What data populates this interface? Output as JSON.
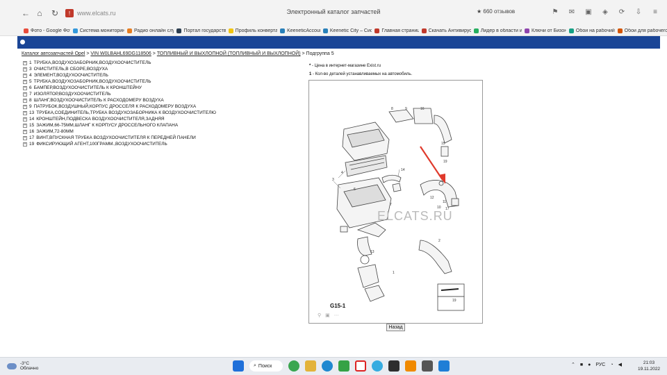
{
  "browser": {
    "url": "www.elcats.ru",
    "title": "Электронный каталог запчастей",
    "reviews": "★ 660 отзывов",
    "bookmarks": [
      {
        "label": "Фото - Google Фото",
        "color": "#e74c3c"
      },
      {
        "label": "Система мониторинга",
        "color": "#3498db"
      },
      {
        "label": "Радио онлайн слу...",
        "color": "#e67e22"
      },
      {
        "label": "Портал государств...",
        "color": "#2c3e50"
      },
      {
        "label": "Профиль конверта...",
        "color": "#f1c40f"
      },
      {
        "label": "KeeneticAccount",
        "color": "#2980b9"
      },
      {
        "label": "Keenetic City – Сис...",
        "color": "#2980b9"
      },
      {
        "label": "Главная страница",
        "color": "#c0392b"
      },
      {
        "label": "Скачать Антивирус...",
        "color": "#c0392b"
      },
      {
        "label": "Лидер в области и...",
        "color": "#27ae60"
      },
      {
        "label": "Ключи от Бизона",
        "color": "#8e44ad"
      },
      {
        "label": "Обои на рабочий...",
        "color": "#16a085"
      },
      {
        "label": "Обои для рабочего...",
        "color": "#d35400"
      }
    ]
  },
  "breadcrumb": {
    "catalog": "Каталог автозапчастей Opel",
    "vin": "VIN W0LBAHL69DG118506",
    "section": "ТОПЛИВНЫЙ И ВЫХЛОПНОЙ (ТОПЛИВНЫЙ И ВЫХЛОПНОЙ)",
    "current": "> Подгруппа 5",
    "sep": ">"
  },
  "parts": [
    {
      "num": "1",
      "name": "ТРУБКА,ВОЗДУХОЗАБОРНИК,ВОЗДУХООЧИСТИТЕЛЬ"
    },
    {
      "num": "3",
      "name": "ОЧИСТИТЕЛЬ,В СБОРЕ,ВОЗДУХА"
    },
    {
      "num": "4",
      "name": "ЭЛЕМЕНТ,ВОЗДУХООЧИСТИТЕЛЬ"
    },
    {
      "num": "5",
      "name": "ТРУБКА,ВОЗДУХОЗАБОРНИК,ВОЗДУХООЧИСТИТЕЛЬ"
    },
    {
      "num": "6",
      "name": "БАМПЕР,ВОЗДУХООЧИСТИТЕЛЬ К КРОНШТЕЙНУ"
    },
    {
      "num": "7",
      "name": "ИЗОЛЯТОР,ВОЗДУХООЧИСТИТЕЛЬ"
    },
    {
      "num": "8",
      "name": "ШЛАНГ,ВОЗДУХООЧИСТИТЕЛЬ К РАСХОДОМЕРУ ВОЗДУХА"
    },
    {
      "num": "9",
      "name": "ПАТРУБОК,ВОЗДУШНЫЙ,КОРПУС ДРОССЕЛЯ К РАСХОДОМЕРУ ВОЗДУХА"
    },
    {
      "num": "13",
      "name": "ТРУБКА,СОЕДИНИТЕЛЬ,ТРУБКА ВОЗДУХОЗАБОРНИКА К ВОЗДУХООЧИСТИТЕЛЮ"
    },
    {
      "num": "14",
      "name": "КРОНШТЕЙН,ПОДВЕСКА ВОЗДУХООЧИСТИТЕЛЯ,ЗАДНЯЯ"
    },
    {
      "num": "15",
      "name": "ЗАЖИМ,66-75ММ,ШЛАНГ К КОРПУСУ ДРОССЕЛЬНОГО КЛАПАНА"
    },
    {
      "num": "16",
      "name": "ЗАЖИМ,72-80ММ"
    },
    {
      "num": "17",
      "name": "ВИНТ,ВПУСКНАЯ ТРУБКА ВОЗДУХООЧИСТИТЕЛЯ К ПЕРЕДНЕЙ ПАНЕЛИ"
    },
    {
      "num": "19",
      "name": "ФИКСИРУЮЩИЙ АГЕНТ,100ГРАММ.,ВОЗДУХООЧИСТИТЕЛЬ"
    }
  ],
  "notes": {
    "price_mark": "*",
    "price_text": " - Цена в интернет-магазине Exist.ru",
    "qty_mark": "1",
    "qty_text": " - Кол-во деталей устанавливаемых на автомобиль."
  },
  "diagram": {
    "code": "G15-1",
    "watermark": "ELCATS.RU",
    "callouts": [
      "8",
      "9",
      "16",
      "15",
      "19",
      "14",
      "4",
      "3",
      "6",
      "7",
      "12",
      "11",
      "10",
      "17",
      "13",
      "2",
      "1",
      "19"
    ]
  },
  "back_button": "Назад",
  "taskbar": {
    "temperature": "-3°C",
    "weather": "Облачно",
    "search": "Поиск",
    "lang": "РУС",
    "time": "21:03",
    "date": "19.11.2022"
  },
  "colors": {
    "banner": "#1a4596",
    "arrow": "#e03a2c"
  }
}
